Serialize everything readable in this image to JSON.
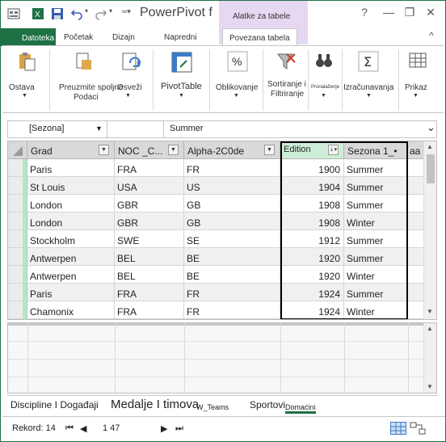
{
  "window": {
    "title": "PowerPivot f",
    "context_tab_title": "Alatke za tabele",
    "help": "?",
    "minimize": "—",
    "restore": "❐",
    "close": "✕",
    "collapse": "^"
  },
  "tabs": {
    "file": "Datoteka",
    "home": "Početak",
    "design": "Dizajn",
    "advanced": "Napredni",
    "linked_table": "Povezana tabela"
  },
  "ribbon": {
    "keep": "Ostava",
    "update_all_1": "Preuzmite spoljne",
    "update_all_2": "Podaci",
    "refresh": "Osveži",
    "pivot_table": "PivotTable",
    "formatting": "Oblikovanje",
    "sort_1": "Sortiranje i",
    "sort_2": "Filtriranje",
    "find": "Pronalaženje",
    "calculations": "Izračunavanja",
    "view": "Prikaz",
    "dropdown_arrow": "▼"
  },
  "filter_bar": {
    "field": "[Sezona]",
    "value": "Summer",
    "expand": "⌄"
  },
  "columns": [
    "Grad",
    "NOC _C...",
    "Alpha-2C0de",
    "Edition",
    "Sezona 1_•",
    "aa 'a"
  ],
  "rows": [
    [
      "Paris",
      "FRA",
      "FR",
      "1900",
      "Summer"
    ],
    [
      "St Louis",
      "USA",
      "US",
      "1904",
      "Summer"
    ],
    [
      "London",
      "GBR",
      "GB",
      "1908",
      "Summer"
    ],
    [
      "London",
      "GBR",
      "GB",
      "1908",
      "Winter"
    ],
    [
      "Stockholm",
      "SWE",
      "SE",
      "1912",
      "Summer"
    ],
    [
      "Antwerpen",
      "BEL",
      "BE",
      "1920",
      "Summer"
    ],
    [
      "Antwerpen",
      "BEL",
      "BE",
      "1920",
      "Winter"
    ],
    [
      "Paris",
      "FRA",
      "FR",
      "1924",
      "Summer"
    ],
    [
      "Chamonix",
      "FRA",
      "FR",
      "1924",
      "Winter"
    ]
  ],
  "sheets": {
    "s1": "Discipline I Događaji",
    "s2": "Medalje I timova",
    "s3": "W_Teams",
    "s4": "Sportovi",
    "s5": "Domaćini"
  },
  "status": {
    "record_label": "Rekord: 14",
    "record_of": "1 47"
  },
  "colors": {
    "accent": "#1e7145",
    "context": "#e6d8f2"
  }
}
